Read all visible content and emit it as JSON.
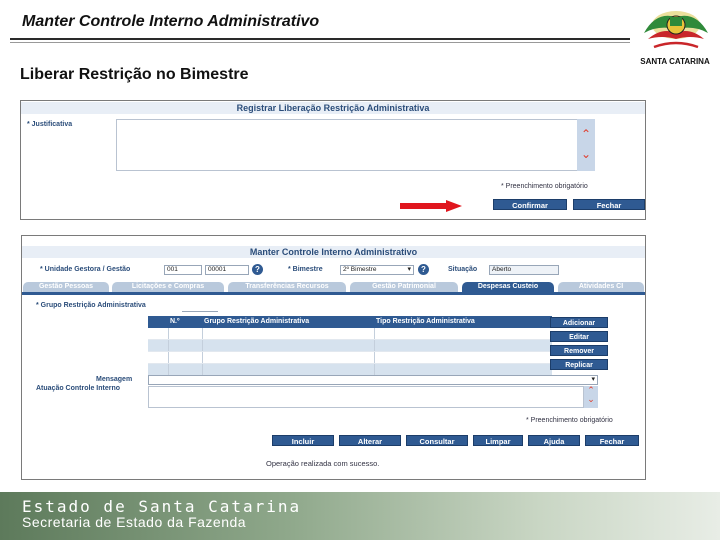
{
  "slide": {
    "title": "Manter Controle Interno Administrativo",
    "subtitle": "Liberar Restrição no Bimestre"
  },
  "logo": {
    "caption": "SANTA CATARINA",
    "icon": "state-coat-of-arms-icon"
  },
  "top_panel": {
    "header": "Registrar Liberação Restrição Administrativa",
    "justificativa_label": "* Justificativa",
    "required_note": "* Preenchimento obrigatório",
    "confirm_label": "Confirmar",
    "close_label": "Fechar"
  },
  "bottom_panel": {
    "header": "Manter Controle Interno Administrativo",
    "unidade_label": "* Unidade Gestora / Gestão",
    "unidade_value": "001",
    "gestao_value": "00001",
    "bimestre_label": "* Bimestre",
    "bimestre_value": "2º Bimestre",
    "situacao_label": "Situação",
    "situacao_value": "Aberto",
    "tabs": [
      {
        "label": "Gestão Pessoas"
      },
      {
        "label": "Licitações e Compras"
      },
      {
        "label": "Transferências Recursos"
      },
      {
        "label": "Gestão Patrimonial"
      },
      {
        "label": "Despesas Custeio"
      },
      {
        "label": "Atividades CI"
      }
    ],
    "grupo_label": "* Grupo Restrição Administrativa",
    "grid": {
      "columns": [
        "N.º",
        "Grupo Restrição Administrativa",
        "Tipo Restrição Administrativa"
      ]
    },
    "side_buttons": [
      "Adicionar",
      "Editar",
      "Remover",
      "Replicar"
    ],
    "mensagem_label": "Mensagem",
    "atuacao_label": "Atuação Controle Interno",
    "required_note": "* Preenchimento obrigatório",
    "action_buttons": [
      "Incluir",
      "Alterar",
      "Consultar",
      "Limpar",
      "Ajuda",
      "Fechar"
    ],
    "status_message": "Operação realizada com sucesso."
  },
  "footer": {
    "line1": "Estado de Santa Catarina",
    "line2": "Secretaria de Estado da Fazenda"
  }
}
